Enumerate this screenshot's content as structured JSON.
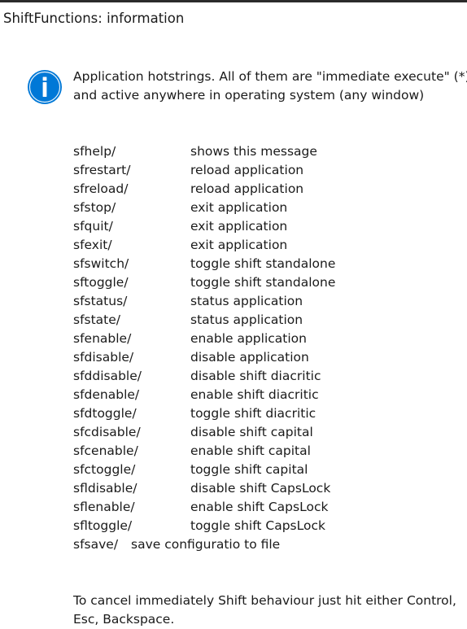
{
  "window": {
    "title": "ShiftFunctions: information"
  },
  "icon": {
    "name": "info-icon",
    "color": "#0078d7",
    "glyph": "i"
  },
  "message": {
    "lines": [
      "Application hotstrings. All of them are \"immediate execute\" (*)",
      "and active anywhere in operating system (any window)"
    ]
  },
  "commands": [
    {
      "cmd": "sfhelp/",
      "desc": "shows this message"
    },
    {
      "cmd": "sfrestart/",
      "desc": "reload application"
    },
    {
      "cmd": "sfreload/",
      "desc": "reload application"
    },
    {
      "cmd": "sfstop/",
      "desc": "exit application"
    },
    {
      "cmd": "sfquit/",
      "desc": "exit application"
    },
    {
      "cmd": "sfexit/",
      "desc": "exit application"
    },
    {
      "cmd": "sfswitch/",
      "desc": "toggle shift standalone"
    },
    {
      "cmd": "sftoggle/",
      "desc": "toggle shift standalone"
    },
    {
      "cmd": "sfstatus/",
      "desc": "status application"
    },
    {
      "cmd": "sfstate/",
      "desc": "status application"
    },
    {
      "cmd": "sfenable/",
      "desc": "enable application"
    },
    {
      "cmd": "sfdisable/",
      "desc": "disable application"
    },
    {
      "cmd": "sfddisable/",
      "desc": "disable shift diacritic"
    },
    {
      "cmd": "sfdenable/",
      "desc": "enable shift diacritic"
    },
    {
      "cmd": "sfdtoggle/",
      "desc": "toggle shift diacritic"
    },
    {
      "cmd": "sfcdisable/",
      "desc": "disable shift capital"
    },
    {
      "cmd": "sfcenable/",
      "desc": "enable shift capital"
    },
    {
      "cmd": "sfctoggle/",
      "desc": "toggle shift capital"
    },
    {
      "cmd": "sfldisable/",
      "desc": "disable shift CapsLock"
    },
    {
      "cmd": "sflenable/",
      "desc": "enable shift CapsLock"
    },
    {
      "cmd": "sfltoggle/",
      "desc": "toggle shift CapsLock"
    },
    {
      "cmd": "sfsave/",
      "desc": "save configuratio to file"
    }
  ],
  "footer": {
    "lines": [
      "To cancel immediately Shift behaviour just hit either Control,",
      "Esc, Backspace."
    ]
  }
}
